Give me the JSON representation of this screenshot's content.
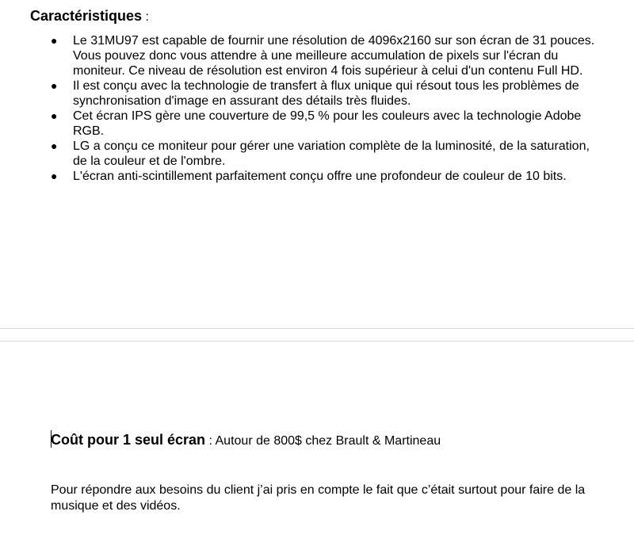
{
  "section": {
    "heading_bold": "Caractéristiques",
    "heading_colon": " :",
    "bullet_glyph": "●",
    "bullets": [
      "Le 31MU97 est capable de fournir une résolution de 4096x2160 sur son écran de 31 pouces. Vous pouvez donc vous attendre à une meilleure accumulation de pixels sur l'écran du moniteur. Ce niveau de résolution est environ 4 fois supérieur à celui d'un contenu Full HD.",
      "Il est conçu avec la technologie de transfert à flux unique qui résout tous les problèmes de synchronisation d'image en assurant des détails très fluides.",
      "Cet écran IPS gère une couverture de 99,5 % pour les couleurs avec la technologie Adobe RGB.",
      "LG a conçu ce moniteur pour gérer une variation complète de la luminosité, de la saturation, de la couleur et de l'ombre.",
      "L'écran anti-scintillement parfaitement conçu offre une profondeur de couleur de 10 bits."
    ]
  },
  "cost": {
    "label_bold": "Coût pour 1 seul écran",
    "label_rest": " : Autour de 800$ chez Brault & Martineau"
  },
  "closing": {
    "text": "Pour répondre aux besoins du client j’ai pris en compte le fait que c’était surtout pour faire de la musique et des vidéos."
  }
}
